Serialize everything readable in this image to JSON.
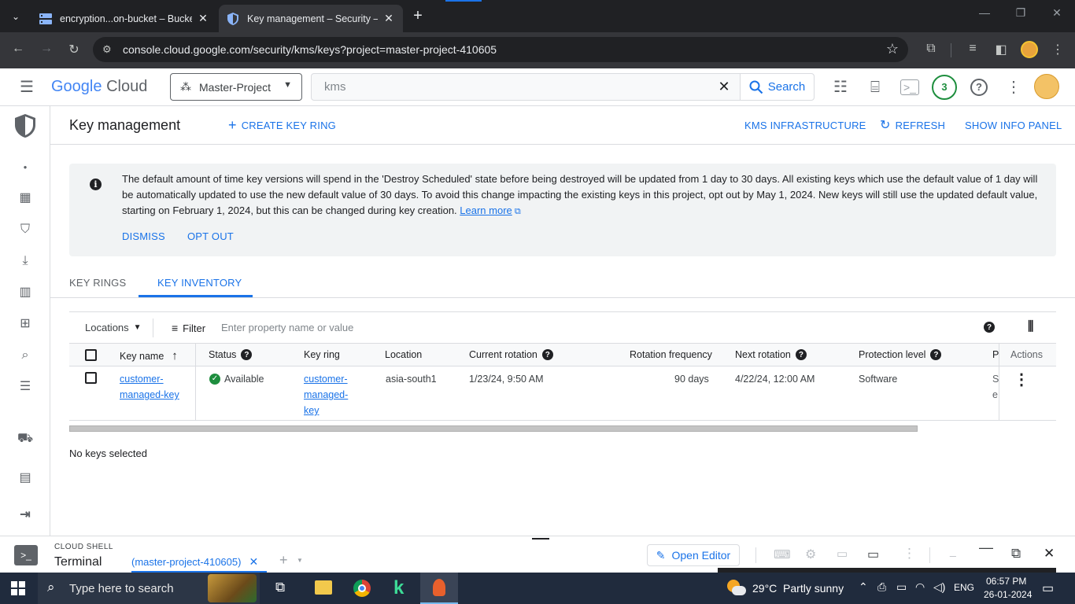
{
  "browser": {
    "tabs": [
      {
        "title": "encryption...on-bucket – Bucket"
      },
      {
        "title": "Key management – Security – M"
      }
    ],
    "url": "console.cloud.google.com/security/kms/keys?project=master-project-410605"
  },
  "header": {
    "logo_google": "Google",
    "logo_cloud": "Cloud",
    "project": "Master-Project",
    "search_value": "kms",
    "search_label": "Search",
    "notification_count": "3"
  },
  "page": {
    "title": "Key management",
    "create_key_ring": "CREATE KEY RING",
    "kms_infrastructure": "KMS INFRASTRUCTURE",
    "refresh": "REFRESH",
    "show_info_panel": "SHOW INFO PANEL"
  },
  "banner": {
    "text": "The default amount of time key versions will spend in the 'Destroy Scheduled' state before being destroyed will be updated from 1 day to 30 days. All existing keys which use the default value of 1 day will be automatically updated to use the new default value of 30 days. To avoid this change impacting the existing keys in this project, opt out by May 1, 2024. New keys will still use the updated default value, starting on February 1, 2024, but this can be changed during key creation.",
    "learn_more": "Learn more",
    "dismiss": "DISMISS",
    "opt_out": "OPT OUT"
  },
  "tabs": {
    "key_rings": "KEY RINGS",
    "key_inventory": "KEY INVENTORY"
  },
  "filter": {
    "locations": "Locations",
    "filter_label": "Filter",
    "placeholder": "Enter property name or value"
  },
  "table": {
    "columns": {
      "key_name": "Key name",
      "status": "Status",
      "key_ring": "Key ring",
      "location": "Location",
      "current_rotation": "Current rotation",
      "rotation_frequency": "Rotation frequency",
      "next_rotation": "Next rotation",
      "protection_level": "Protection level",
      "p_trunc": "P",
      "actions": "Actions"
    },
    "row": {
      "key_name_l1": "customer-",
      "key_name_l2": "managed-key",
      "status": "Available",
      "key_ring_l1": "customer-",
      "key_ring_l2": "managed-",
      "key_ring_l3": "key",
      "location": "asia-south1",
      "current_rotation": "1/23/24, 9:50 AM",
      "rotation_frequency": "90 days",
      "next_rotation": "4/22/24, 12:00 AM",
      "protection_level": "Software",
      "p_trunc_l1": "S",
      "p_trunc_l2": "e"
    },
    "selection_status": "No keys selected"
  },
  "cloud_shell": {
    "label": "CLOUD SHELL",
    "terminal": "Terminal",
    "session_tab": "(master-project-410605)",
    "open_editor": "Open Editor"
  },
  "taskbar": {
    "search_placeholder": "Type here to search",
    "weather": "29°C  Partly sunny",
    "lang": "ENG",
    "time": "06:57 PM",
    "date": "26-01-2024"
  }
}
